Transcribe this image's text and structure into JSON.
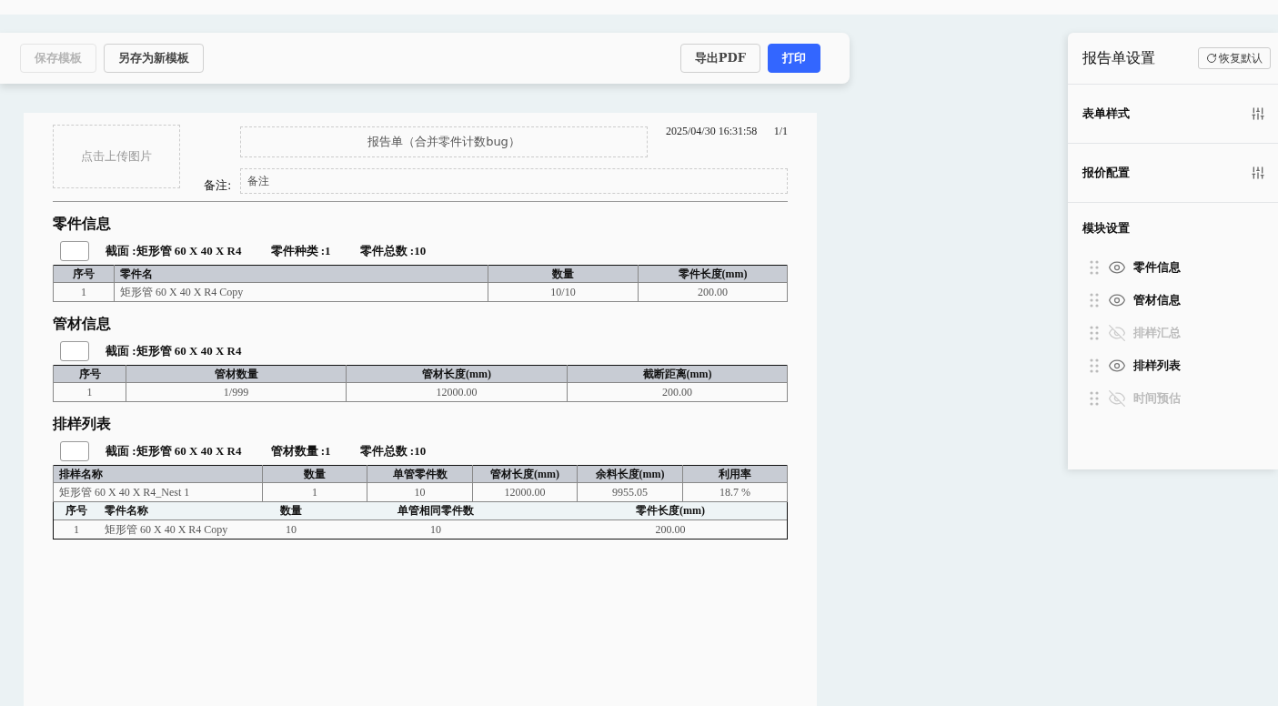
{
  "toolbar": {
    "buttons": [
      {
        "label": "保存模板",
        "kind": "default",
        "disabled": true
      },
      {
        "label": "另存为新模板",
        "kind": "default",
        "disabled": false
      },
      {
        "label": "导出PDF",
        "kind": "default",
        "disabled": false
      },
      {
        "label": "打印",
        "kind": "primary",
        "disabled": false
      }
    ]
  },
  "report": {
    "image_upload": "点击上传图片",
    "title": "报告单（合并零件计数bug）",
    "timestamp": "2025/04/30 16:31:58",
    "page": "1/1",
    "remark_label": "备注:",
    "remark_placeholder": "备注",
    "sections": [
      {
        "title": "零件信息",
        "summary": [
          "截面 :矩形管 60 X 40 X R4",
          "零件种类 :1",
          "零件总数 :10"
        ],
        "table": {
          "columns": [
            "序号",
            "零件名",
            "数量",
            "零件长度(mm)"
          ],
          "rows": [
            {
              "cells": [
                "1",
                "矩形管 60 X 40 X R4 Copy",
                "10/10",
                "200.00"
              ]
            }
          ]
        }
      },
      {
        "title": "管材信息",
        "summary": [
          "截面 :矩形管 60 X 40 X R4"
        ],
        "table": {
          "columns": [
            "序号",
            "管材数量",
            "管材长度(mm)",
            "截断距离(mm)"
          ],
          "rows": [
            {
              "cells": [
                "1",
                "1/999",
                "12000.00",
                "200.00"
              ]
            }
          ]
        }
      },
      {
        "title": "排样列表",
        "summary": [
          "截面 :矩形管 60 X 40 X R4",
          "管材数量 :1",
          "零件总数 :10"
        ],
        "table": {
          "columns": [
            "排样名称",
            "数量",
            "单管零件数",
            "管材长度(mm)",
            "余料长度(mm)",
            "利用率"
          ],
          "rows": [
            {
              "cells": [
                "矩形管 60 X 40 X R4_Nest 1",
                "1",
                "10",
                "12000.00",
                "9955.05",
                "18.7 %"
              ],
              "sub_table": {
                "columns": [
                  "序号",
                  "零件名称",
                  "数量",
                  "单管相同零件数",
                  "零件长度(mm)"
                ],
                "rows": [
                  {
                    "cells": [
                      "1",
                      "矩形管 60 X 40 X R4 Copy",
                      "10",
                      "10",
                      "200.00"
                    ]
                  }
                ]
              }
            }
          ]
        }
      }
    ]
  },
  "settings": {
    "title": "报告单设置",
    "reset_button": "恢复默认",
    "groups": [
      {
        "label": "表单样式"
      },
      {
        "label": "报价配置"
      }
    ],
    "modules_title": "模块设置",
    "modules": [
      {
        "label": "零件信息",
        "visible": true
      },
      {
        "label": "管材信息",
        "visible": true
      },
      {
        "label": "排样汇总",
        "visible": false
      },
      {
        "label": "排样列表",
        "visible": true
      },
      {
        "label": "时间预估",
        "visible": false
      }
    ]
  }
}
